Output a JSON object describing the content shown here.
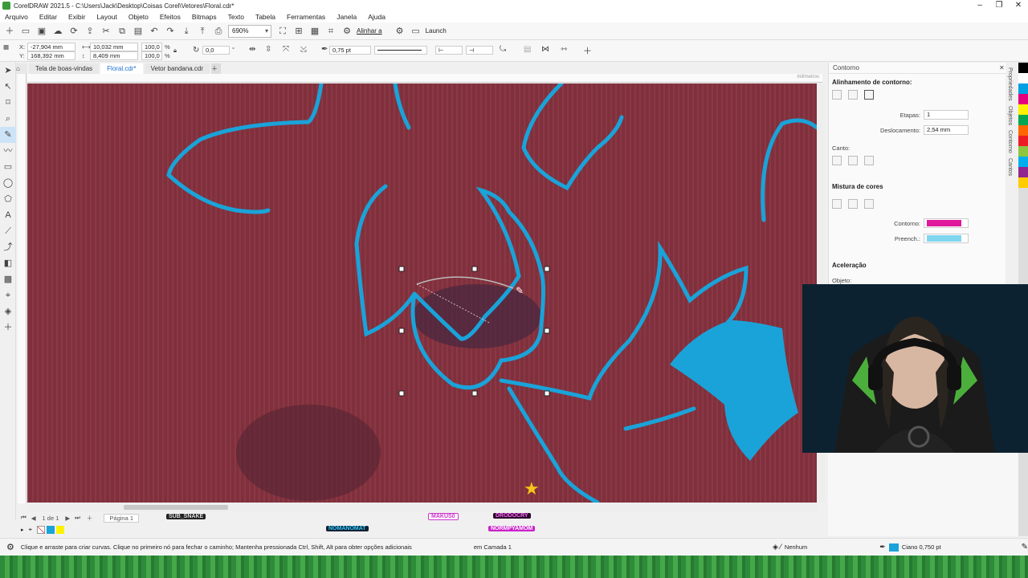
{
  "window": {
    "title": "CorelDRAW 2021.5 - C:\\Users\\Jack\\Desktop\\Coisas Corel\\Vetores\\Floral.cdr*"
  },
  "menu": [
    "Arquivo",
    "Editar",
    "Exibir",
    "Layout",
    "Objeto",
    "Efeitos",
    "Bitmaps",
    "Texto",
    "Tabela",
    "Ferramentas",
    "Janela",
    "Ajuda"
  ],
  "toolbar": {
    "zoom": "690%",
    "align_label": "Alinhar a",
    "launch_label": "Launch"
  },
  "propbar": {
    "x": "-27,904 mm",
    "y": "168,392 mm",
    "w": "10,032 mm",
    "h": "8,409 mm",
    "sx": "100,0",
    "sy": "100,0",
    "pct": "%",
    "angle": "0,0",
    "outline": "0,75 pt"
  },
  "tabs": [
    "Tela de boas-vindas",
    "Floral.cdr*",
    "Vetor bandana.cdr"
  ],
  "ruler": {
    "unit": "milímetros"
  },
  "docker": {
    "title": "Contorno",
    "align_section": "Alinhamento de contorno:",
    "steps_label": "Etapas:",
    "steps_value": "1",
    "offset_label": "Deslocamento:",
    "offset_value": "2,54 mm",
    "corner_label": "Canto:",
    "mix_section": "Mistura de cores",
    "contour_label": "Contorno:",
    "fill_label": "Preench.:",
    "accel_section": "Aceleração",
    "object_label": "Objeto:",
    "contour_color": "#e0169c",
    "fill_color": "#7fd6ee"
  },
  "sidetabs": [
    "Propriedades",
    "Objetos",
    "Contorno",
    "Cantos"
  ],
  "pagebar": {
    "page_count": "1 de 1",
    "page_name": "Página 1"
  },
  "overlay_tags": [
    "SUB_SNAKE",
    "NOMANOMAT",
    "MAKUS0",
    "DRODOCRY",
    "NORMPYAMOM"
  ],
  "status": {
    "hint": "Clique e arraste para criar curvas. Clique no primeiro nó para fechar o caminho; Mantenha pressionada Ctrl, Shift, Alt para obter opções adicionais",
    "layer": "em Camada 1",
    "fill": "Nenhum",
    "outline": "Ciano 0,750 pt",
    "outline_color": "#1aa3d9"
  },
  "stroke_color": "#1aa3d9",
  "palette": [
    "#000000",
    "#ffffff",
    "#00a0e3",
    "#e4007c",
    "#fff200",
    "#00a651",
    "#ff6600",
    "#ed1c24",
    "#8dc63f",
    "#00aeef",
    "#92278f",
    "#ffcc00"
  ]
}
